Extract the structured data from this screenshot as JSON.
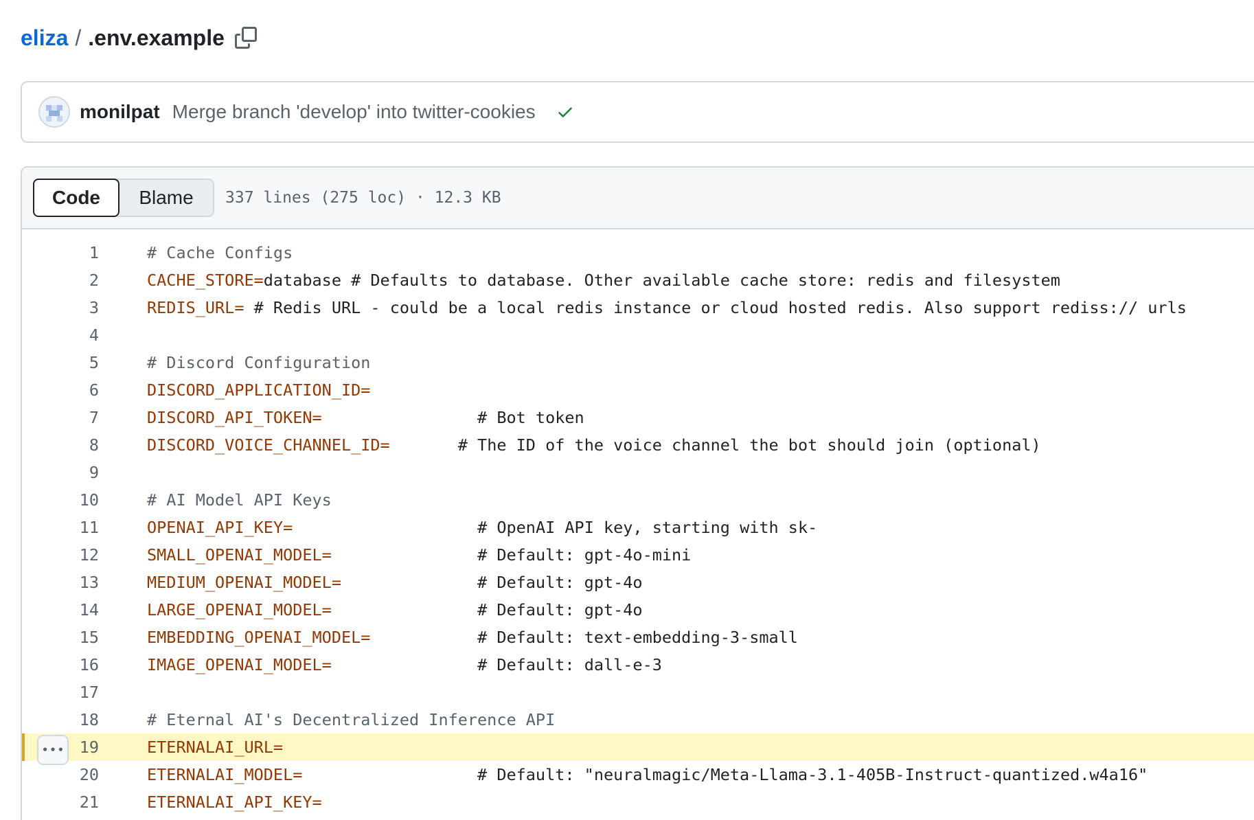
{
  "breadcrumb": {
    "repo": "eliza",
    "separator": "/",
    "file": ".env.example"
  },
  "commit": {
    "author": "monilpat",
    "message": "Merge branch 'develop' into twitter-cookies",
    "status": "success",
    "status_color": "#1a7f37"
  },
  "file_header": {
    "code_label": "Code",
    "blame_label": "Blame",
    "info": "337 lines (275 loc) · 12.3 KB"
  },
  "colors": {
    "link": "#0969da",
    "key": "#953800",
    "comment": "#59636e",
    "highlight": "#fff8c5"
  },
  "lines": [
    {
      "n": "1",
      "key": "",
      "value": "",
      "comment": "# Cache Configs",
      "pad": ""
    },
    {
      "n": "2",
      "key": "CACHE_STORE=",
      "value": "database",
      "comment": " # Defaults to database. Other available cache store: redis and filesystem",
      "pad": ""
    },
    {
      "n": "3",
      "key": "REDIS_URL=",
      "value": "",
      "comment": " # Redis URL - could be a local redis instance or cloud hosted redis. Also support rediss:// urls",
      "pad": ""
    },
    {
      "n": "4",
      "key": "",
      "value": "",
      "comment": "",
      "pad": ""
    },
    {
      "n": "5",
      "key": "",
      "value": "",
      "comment": "# Discord Configuration",
      "pad": ""
    },
    {
      "n": "6",
      "key": "DISCORD_APPLICATION_ID=",
      "value": "",
      "comment": "",
      "pad": ""
    },
    {
      "n": "7",
      "key": "DISCORD_API_TOKEN=",
      "value": "",
      "comment": "# Bot token",
      "pad": "                "
    },
    {
      "n": "8",
      "key": "DISCORD_VOICE_CHANNEL_ID=",
      "value": "",
      "comment": "# The ID of the voice channel the bot should join (optional)",
      "pad": "       "
    },
    {
      "n": "9",
      "key": "",
      "value": "",
      "comment": "",
      "pad": ""
    },
    {
      "n": "10",
      "key": "",
      "value": "",
      "comment": "# AI Model API Keys",
      "pad": ""
    },
    {
      "n": "11",
      "key": "OPENAI_API_KEY=",
      "value": "",
      "comment": "# OpenAI API key, starting with sk-",
      "pad": "                   "
    },
    {
      "n": "12",
      "key": "SMALL_OPENAI_MODEL=",
      "value": "",
      "comment": "# Default: gpt-4o-mini",
      "pad": "               "
    },
    {
      "n": "13",
      "key": "MEDIUM_OPENAI_MODEL=",
      "value": "",
      "comment": "# Default: gpt-4o",
      "pad": "              "
    },
    {
      "n": "14",
      "key": "LARGE_OPENAI_MODEL=",
      "value": "",
      "comment": "# Default: gpt-4o",
      "pad": "               "
    },
    {
      "n": "15",
      "key": "EMBEDDING_OPENAI_MODEL=",
      "value": "",
      "comment": "# Default: text-embedding-3-small",
      "pad": "           "
    },
    {
      "n": "16",
      "key": "IMAGE_OPENAI_MODEL=",
      "value": "",
      "comment": "# Default: dall-e-3",
      "pad": "               "
    },
    {
      "n": "17",
      "key": "",
      "value": "",
      "comment": "",
      "pad": ""
    },
    {
      "n": "18",
      "key": "",
      "value": "",
      "comment": "# Eternal AI's Decentralized Inference API",
      "pad": ""
    },
    {
      "n": "19",
      "key": "ETERNALAI_URL=",
      "value": "",
      "comment": "",
      "pad": "",
      "highlight": true
    },
    {
      "n": "20",
      "key": "ETERNALAI_MODEL=",
      "value": "",
      "comment": "# Default: \"neuralmagic/Meta-Llama-3.1-405B-Instruct-quantized.w4a16\"",
      "pad": "                  "
    },
    {
      "n": "21",
      "key": "ETERNALAI_API_KEY=",
      "value": "",
      "comment": "",
      "pad": ""
    }
  ]
}
